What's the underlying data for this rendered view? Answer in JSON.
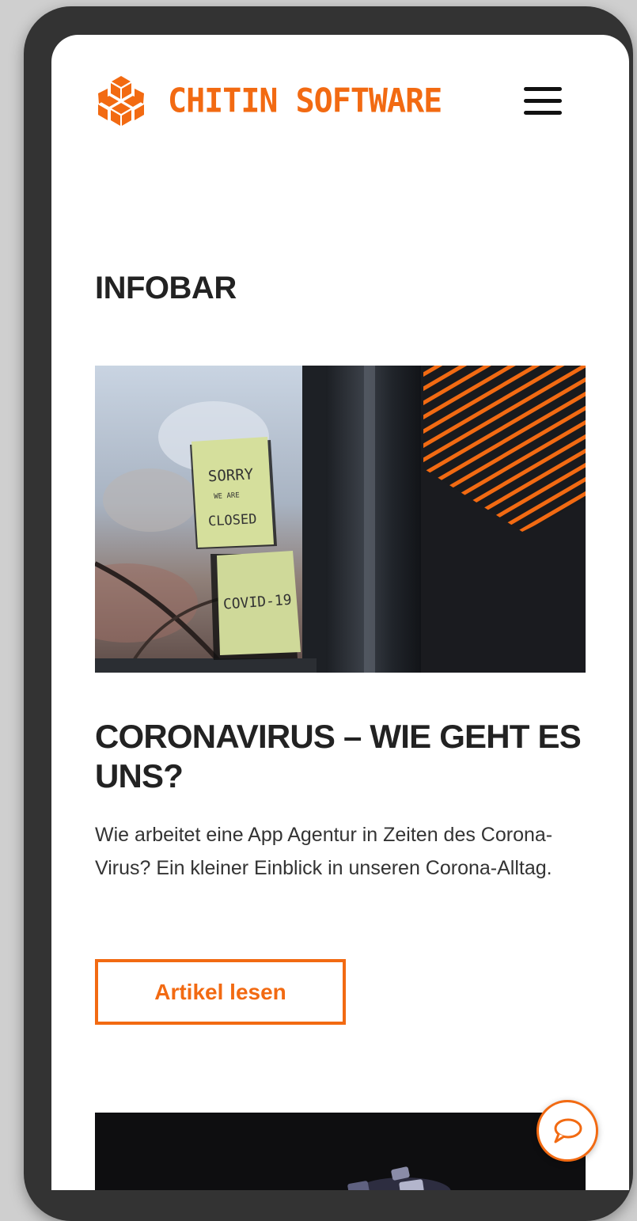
{
  "brand": {
    "name": "CHITIN SOFTWARE",
    "accent_color": "#f26a12",
    "logo_icon": "hexagon-cube-logo"
  },
  "header": {
    "menu_icon": "hamburger-menu-icon"
  },
  "section": {
    "title": "INFOBAR"
  },
  "article": {
    "image_icon": "closed-sign-photo",
    "image_notes": [
      "SORRY",
      "WE ARE",
      "CLOSED",
      "COVID-19"
    ],
    "title": "CORONAVIRUS – WIE GEHT ES UNS?",
    "excerpt": "Wie arbeitet eine App Agentur in Zeiten des Corona-Virus? Ein kleiner Einblick in unseren Corona-Alltag.",
    "button_label": "Artikel lesen"
  },
  "chat": {
    "icon": "chat-bubble-icon"
  }
}
